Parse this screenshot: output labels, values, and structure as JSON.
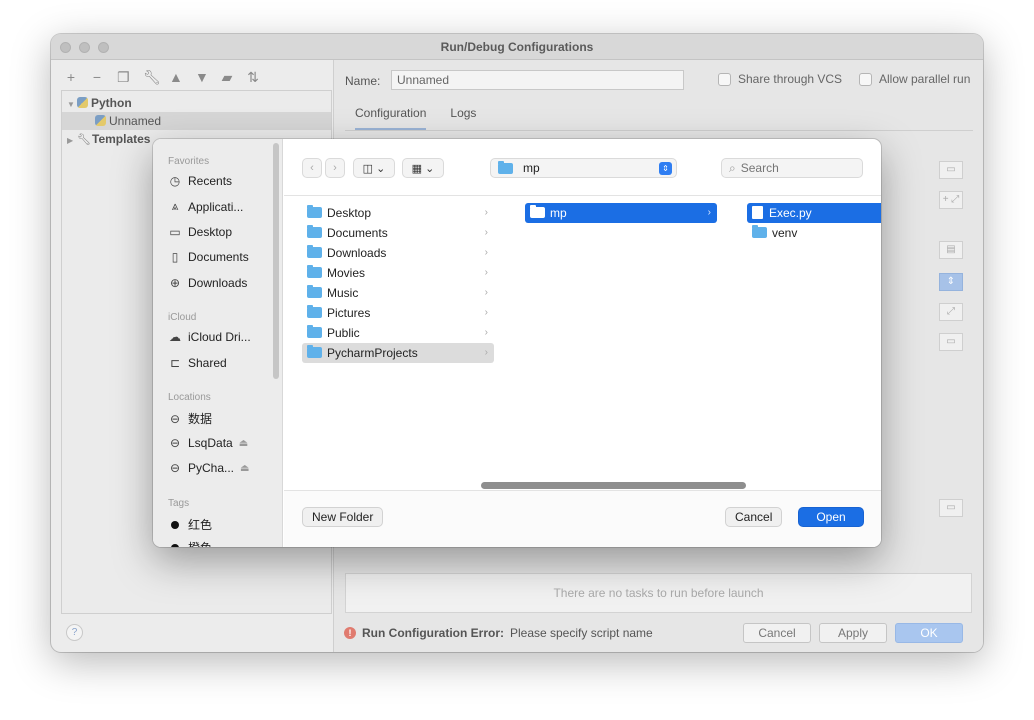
{
  "window": {
    "title": "Run/Debug Configurations",
    "name_label": "Name:",
    "name_value": "Unnamed",
    "share_vcs": "Share through VCS",
    "allow_parallel": "Allow parallel run",
    "tabs": [
      "Configuration",
      "Logs"
    ],
    "tree": {
      "python": "Python",
      "unnamed": "Unnamed",
      "templates": "Templates"
    },
    "no_tasks": "There are no tasks to run before launch",
    "error_label": "Run Configuration Error:",
    "error_text": "Please specify script name",
    "buttons": {
      "cancel": "Cancel",
      "apply": "Apply",
      "ok": "OK"
    },
    "help": "?"
  },
  "dialog": {
    "sidebar": {
      "favorites_header": "Favorites",
      "favorites": [
        {
          "label": "Recents",
          "icon": "clock-icon"
        },
        {
          "label": "Applicati...",
          "icon": "applications-icon"
        },
        {
          "label": "Desktop",
          "icon": "desktop-icon"
        },
        {
          "label": "Documents",
          "icon": "document-icon"
        },
        {
          "label": "Downloads",
          "icon": "download-icon"
        }
      ],
      "icloud_header": "iCloud",
      "icloud": [
        {
          "label": "iCloud Dri...",
          "icon": "cloud-icon"
        },
        {
          "label": "Shared",
          "icon": "shared-folder-icon"
        }
      ],
      "locations_header": "Locations",
      "locations": [
        {
          "label": "数据",
          "icon": "drive-icon"
        },
        {
          "label": "LsqData",
          "icon": "drive-icon"
        },
        {
          "label": "PyCha...",
          "icon": "drive-icon"
        }
      ],
      "tags_header": "Tags",
      "tags": [
        {
          "label": "红色"
        },
        {
          "label": "橙色"
        }
      ]
    },
    "current_folder": "mp",
    "search_placeholder": "Search",
    "column1": [
      "Desktop",
      "Documents",
      "Downloads",
      "Movies",
      "Music",
      "Pictures",
      "Public",
      "PycharmProjects"
    ],
    "column2": [
      "mp"
    ],
    "column3": [
      {
        "label": "Exec.py",
        "kind": "file"
      },
      {
        "label": "venv",
        "kind": "folder"
      }
    ],
    "new_folder": "New Folder",
    "cancel": "Cancel",
    "open": "Open"
  },
  "colors": {
    "accent": "#1b6ee4",
    "folder": "#5fb1ea",
    "error": "#e07b6f"
  }
}
